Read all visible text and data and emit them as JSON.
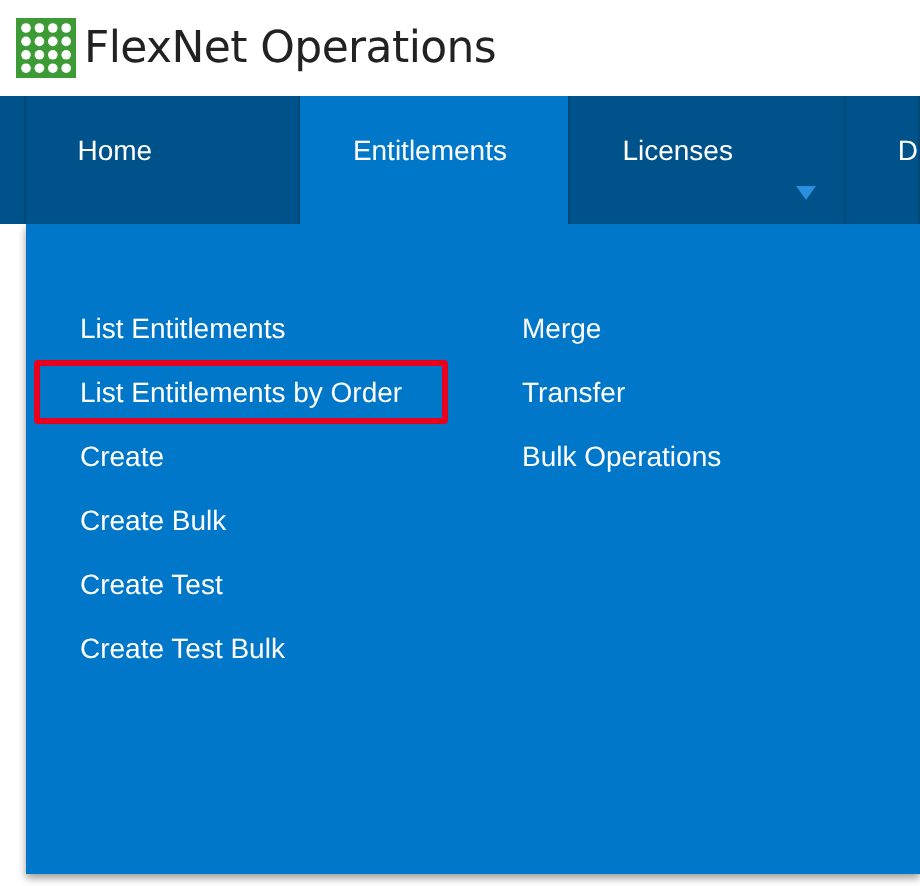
{
  "logo": {
    "text": "FlexNet Operations"
  },
  "tabs": [
    {
      "label": "Home",
      "selected": false,
      "caret": false
    },
    {
      "label": "Entitlements",
      "selected": true,
      "caret": false
    },
    {
      "label": "Licenses",
      "selected": false,
      "caret": true
    },
    {
      "label": "D",
      "selected": false,
      "caret": false
    }
  ],
  "menu": {
    "columns": [
      [
        {
          "label": "List Entitlements",
          "highlighted": false
        },
        {
          "label": "List Entitlements by Order",
          "highlighted": true
        },
        {
          "label": "Create",
          "highlighted": false
        },
        {
          "label": "Create Bulk",
          "highlighted": false
        },
        {
          "label": "Create Test",
          "highlighted": false
        },
        {
          "label": "Create Test Bulk",
          "highlighted": false
        }
      ],
      [
        {
          "label": "Merge",
          "highlighted": false
        },
        {
          "label": "Transfer",
          "highlighted": false
        },
        {
          "label": "Bulk Operations",
          "highlighted": false
        }
      ]
    ]
  }
}
